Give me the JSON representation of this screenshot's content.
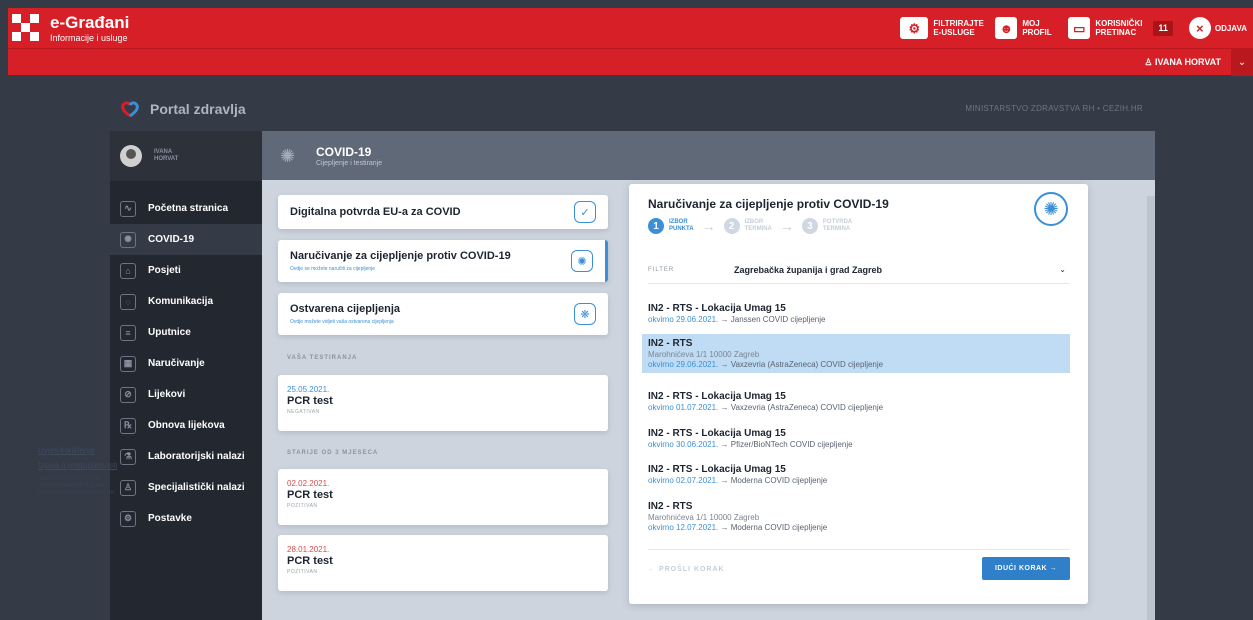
{
  "app": {
    "brand_title": "e-Građani",
    "brand_subtitle": "Informacije i usluge",
    "actions": [
      {
        "label": "FILTRIRAJTE E-USLUGE",
        "icon": "filter-icon"
      },
      {
        "label": "MOJ PROFIL",
        "icon": "profile-icon"
      },
      {
        "label": "KORISNIČKI PRETINAC",
        "icon": "inbox-icon",
        "badge": "11"
      },
      {
        "label": "ODJAVA",
        "icon": "logout-icon"
      }
    ],
    "user_name": "IVANA HORVAT",
    "accent": "#d61f26"
  },
  "portal": {
    "name": "Portal zdravlja",
    "ministry": "MINISTARSTVO ZDRAVSTVA RH • CEZIH.HR"
  },
  "sidebar": {
    "user": "IVANA HORVAT",
    "items": [
      {
        "label": "Početna stranica",
        "icon": "home-icon",
        "active": false
      },
      {
        "label": "COVID-19",
        "icon": "virus-icon",
        "active": true
      },
      {
        "label": "Posjeti",
        "icon": "visit-icon",
        "active": false
      },
      {
        "label": "Komunikacija",
        "icon": "chat-icon",
        "active": false
      },
      {
        "label": "Uputnice",
        "icon": "referral-icon",
        "active": false
      },
      {
        "label": "Naručivanje",
        "icon": "calendar-icon",
        "active": false
      },
      {
        "label": "Lijekovi",
        "icon": "pill-icon",
        "active": false
      },
      {
        "label": "Obnova lijekova",
        "icon": "prescription-icon",
        "active": false
      },
      {
        "label": "Laboratorijski nalazi",
        "icon": "lab-icon",
        "active": false
      },
      {
        "label": "Specijalistički nalazi",
        "icon": "specialist-icon",
        "active": false
      },
      {
        "label": "Postavke",
        "icon": "settings-icon",
        "active": false
      }
    ],
    "links": [
      "Uvjeti korištenja",
      "Izjava o pristupačnosti"
    ],
    "version": "VERZIJA 0.2.0 LIPANJ 2021. DECISION MATRIX TESLA & MINISTARSTVO ZDRAVSTVA RH"
  },
  "header": {
    "title": "COVID-19",
    "subtitle": "Cijepljenje i testiranje"
  },
  "services": [
    {
      "title": "Digitalna potvrda EU-a za COVID",
      "subtitle": "",
      "icon": "certificate-icon"
    },
    {
      "title": "Naručivanje za cijepljenje protiv COVID-19",
      "subtitle": "Ovdje se možete naručiti za cijepljenje",
      "icon": "vaccine-booking-icon"
    },
    {
      "title": "Ostvarena cijepljenja",
      "subtitle": "Ovdje možete vidjeti vaša ostvarena cijepljenja",
      "icon": "vaccine-shield-icon"
    }
  ],
  "tests_label": "VAŠA TESTIRANJA",
  "tests": [
    {
      "date": "25.05.2021.",
      "name": "PCR test",
      "result": "NEGATIVAN"
    }
  ],
  "older_label": "STARIJE OD 3 MJESECA",
  "older_tests": [
    {
      "date": "02.02.2021.",
      "name": "PCR test",
      "result": "POZITIVAN"
    },
    {
      "date": "28.01.2021.",
      "name": "PCR test",
      "result": "POZITIVAN"
    }
  ],
  "booking": {
    "title": "Naručivanje za cijepljenje protiv COVID-19",
    "steps": [
      {
        "num": "1",
        "line1": "IZBOR",
        "line2": "PUNKTA",
        "active": true
      },
      {
        "num": "2",
        "line1": "IZBOR",
        "line2": "TERMINA",
        "active": false
      },
      {
        "num": "3",
        "line1": "POTVRDA",
        "line2": "TERMINA",
        "active": false
      }
    ],
    "filter_label": "FILTER",
    "filter_value": "Zagrebačka županija i grad Zagreb",
    "locations": [
      {
        "name": "IN2 - RTS - Lokacija Umag 15",
        "address": "",
        "date": "okvirno 29.06.2021.",
        "vaccine": "→ Janssen COVID cijepljenje",
        "selected": false
      },
      {
        "name": "IN2 - RTS",
        "address": "Marohnićeva 1/1 10000 Zagreb",
        "date": "okvirno 29.06.2021.",
        "vaccine": "→ Vaxzevria (AstraZeneca) COVID cijepljenje",
        "selected": true
      },
      {
        "name": "IN2 - RTS - Lokacija Umag 15",
        "address": "",
        "date": "okvirno 01.07.2021.",
        "vaccine": "→ Vaxzevria (AstraZeneca) COVID cijepljenje",
        "selected": false
      },
      {
        "name": "IN2 - RTS - Lokacija Umag 15",
        "address": "",
        "date": "okvirno 30.06.2021.",
        "vaccine": "→ Pfizer/BioNTech COVID cijepljenje",
        "selected": false
      },
      {
        "name": "IN2 - RTS - Lokacija Umag 15",
        "address": "",
        "date": "okvirno 02.07.2021.",
        "vaccine": "→ Moderna COVID cijepljenje",
        "selected": false
      },
      {
        "name": "IN2 - RTS",
        "address": "Marohnićeva 1/1 10000 Zagreb",
        "date": "okvirno 12.07.2021.",
        "vaccine": "→ Moderna COVID cijepljenje",
        "selected": false
      }
    ],
    "prev_label": "← PROŠLI KORAK",
    "next_label": "IDUĆI KORAK →"
  }
}
